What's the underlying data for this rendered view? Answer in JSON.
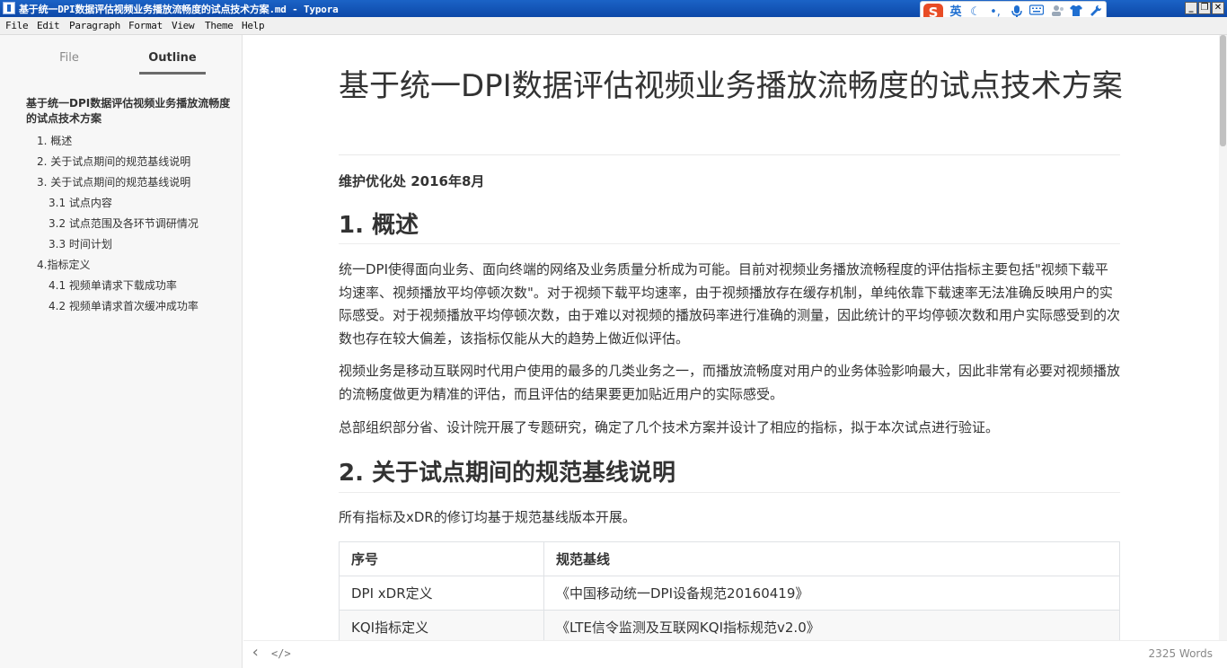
{
  "window": {
    "title": "基于统一DPI数据评估视频业务播放流畅度的试点技术方案.md - Typora",
    "controls": {
      "minimize": "_",
      "restore": "❐",
      "close": "✕"
    }
  },
  "ime": {
    "logo": "S",
    "items": [
      {
        "icon": "lang-icon",
        "label": "英"
      },
      {
        "icon": "moon-icon",
        "label": "☾"
      },
      {
        "icon": "punct-icon",
        "label": "•,"
      },
      {
        "icon": "mic-icon",
        "label": "🎙"
      },
      {
        "icon": "keyboard-icon",
        "label": "⌨"
      },
      {
        "icon": "user-icon",
        "label": "👥"
      },
      {
        "icon": "shirt-icon",
        "label": "👕"
      },
      {
        "icon": "wrench-icon",
        "label": "🔧"
      }
    ]
  },
  "menubar": [
    "File",
    "Edit",
    "Paragraph",
    "Format",
    "View",
    "Theme",
    "Help"
  ],
  "sidebar": {
    "tabs": {
      "file": "File",
      "outline": "Outline"
    },
    "outline": [
      {
        "label": "基于统一DPI数据评估视频业务播放流畅度的试点技术方案",
        "level": 1
      },
      {
        "label": "1. 概述",
        "level": 2
      },
      {
        "label": "2. 关于试点期间的规范基线说明",
        "level": 2
      },
      {
        "label": "3. 关于试点期间的规范基线说明",
        "level": 2
      },
      {
        "label": "3.1 试点内容",
        "level": 3
      },
      {
        "label": "3.2 试点范围及各环节调研情况",
        "level": 3
      },
      {
        "label": "3.3 时间计划",
        "level": 3
      },
      {
        "label": "4.指标定义",
        "level": 2
      },
      {
        "label": "4.1 视频单请求下载成功率",
        "level": 3
      },
      {
        "label": "4.2 视频单请求首次缓冲成功率",
        "level": 3
      }
    ]
  },
  "document": {
    "title": "基于统一DPI数据评估视频业务播放流畅度的试点技术方案",
    "subtitle": "维护优化处 2016年8月",
    "section1": {
      "heading_num": "1.",
      "heading": "概述",
      "paragraphs": [
        "统一DPI使得面向业务、面向终端的网络及业务质量分析成为可能。目前对视频业务播放流畅程度的评估指标主要包括\"视频下载平均速率、视频播放平均停顿次数\"。对于视频下载平均速率，由于视频播放存在缓存机制，单纯依靠下载速率无法准确反映用户的实际感受。对于视频播放平均停顿次数，由于难以对视频的播放码率进行准确的测量，因此统计的平均停顿次数和用户实际感受到的次数也存在较大偏差，该指标仅能从大的趋势上做近似评估。",
        "视频业务是移动互联网时代用户使用的最多的几类业务之一，而播放流畅度对用户的业务体验影响最大，因此非常有必要对视频播放的流畅度做更为精准的评估，而且评估的结果要更加贴近用户的实际感受。",
        "总部组织部分省、设计院开展了专题研究，确定了几个技术方案并设计了相应的指标，拟于本次试点进行验证。"
      ]
    },
    "section2": {
      "heading_num": "2.",
      "heading": "关于试点期间的规范基线说明",
      "paragraph": "所有指标及xDR的修订均基于规范基线版本开展。",
      "table": {
        "headers": [
          "序号",
          "规范基线"
        ],
        "rows": [
          [
            "DPI xDR定义",
            "《中国移动统一DPI设备规范20160419》"
          ],
          [
            "KQI指标定义",
            "《LTE信令监测及互联网KQI指标规范v2.0》"
          ]
        ]
      }
    }
  },
  "footer": {
    "back": "‹",
    "source": "</>",
    "word_count": "2325 Words"
  }
}
